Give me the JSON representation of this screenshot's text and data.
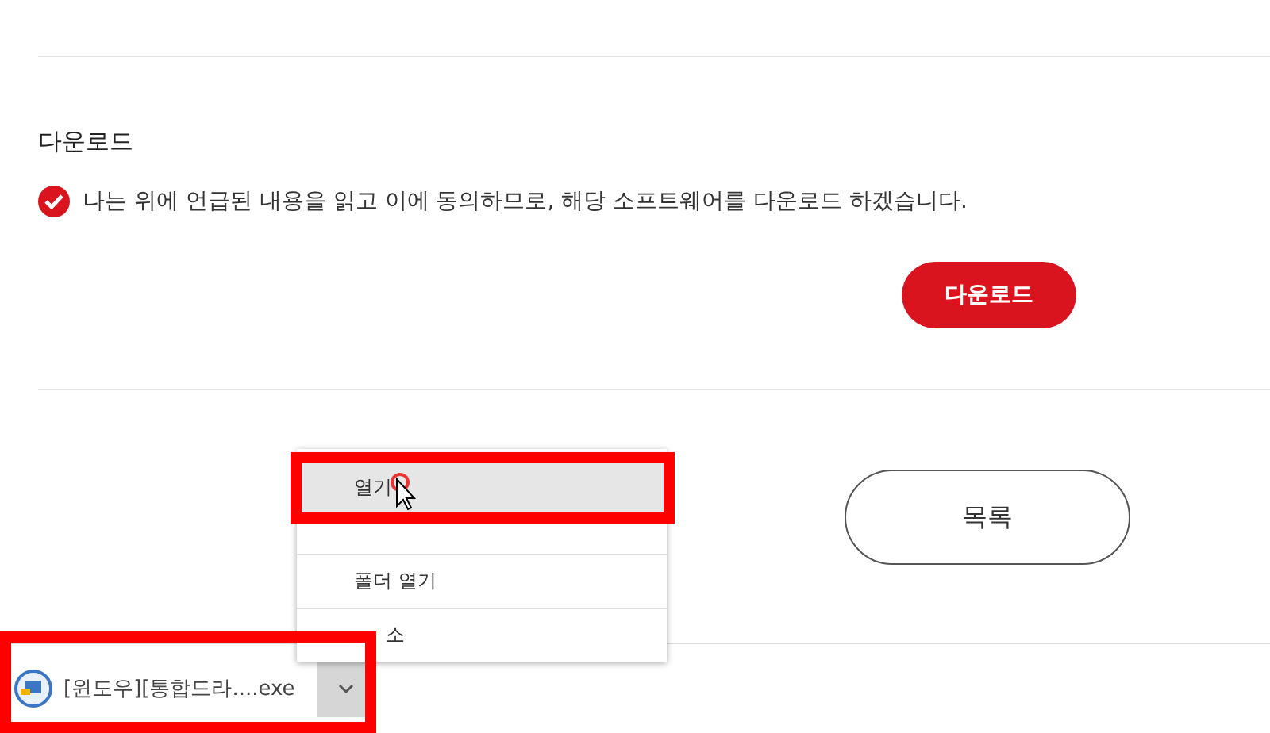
{
  "section": {
    "title": "다운로드"
  },
  "agreement": {
    "text": "나는 위에 언급된 내용을 읽고 이에 동의하므로, 해당 소프트웨어를 다운로드 하겠습니다.",
    "checked": true
  },
  "download_button": {
    "label": "다운로드"
  },
  "list_button": {
    "label": "목록"
  },
  "context_menu": {
    "items": [
      {
        "label": "열기",
        "selected": true
      },
      {
        "selected": false
      },
      {
        "label": "폴더 열기",
        "selected": false
      },
      {
        "label": "소",
        "selected": false
      }
    ]
  },
  "download_bar": {
    "file_name": "[윈도우][통합드라....exe"
  }
}
